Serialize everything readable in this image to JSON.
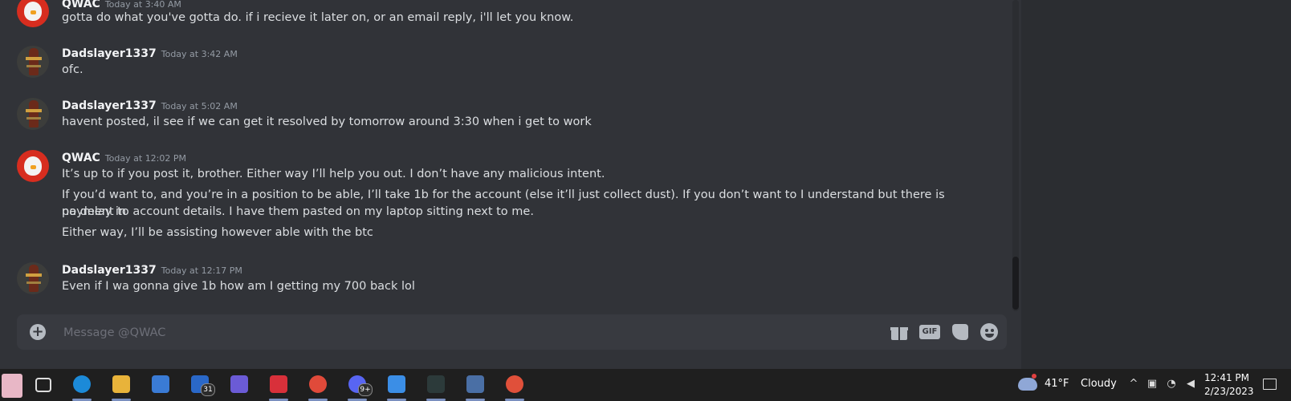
{
  "messages": [
    {
      "author": "QWAC",
      "time": "Today at 3:40 AM",
      "avatar": "qwac",
      "lines": [
        "gotta do what you've gotta do. if i recieve it later on, or an email reply, i'll let you know."
      ]
    },
    {
      "author": "Dadslayer1337",
      "time": "Today at 3:42 AM",
      "avatar": "dad",
      "lines": [
        "ofc."
      ]
    },
    {
      "author": "Dadslayer1337",
      "time": "Today at 5:02 AM",
      "avatar": "dad",
      "lines": [
        "havent posted, il see if we can get it resolved by tomorrow around 3:30 when i get to work"
      ]
    },
    {
      "author": "QWAC",
      "time": "Today at 12:02 PM",
      "avatar": "qwac",
      "lines": [
        "It’s up to if you post it, brother. Either way I’ll help you out. I don’t have any malicious intent.",
        "If you’d want to, and you’re in a position to be able, I’ll take 1b for the account (else it’ll just collect dust). If you don’t want to I understand but there is no delay in",
        "payment to account details. I have them pasted on my laptop sitting next to me.",
        "Either way, I’ll be assisting however able with the btc"
      ]
    },
    {
      "author": "Dadslayer1337",
      "time": "Today at 12:17 PM",
      "avatar": "dad",
      "lines": [
        "Even if I wa gonna give 1b how am I getting my 700 back lol"
      ]
    }
  ],
  "composer": {
    "placeholder": "Message @QWAC",
    "gif_label": "GIF"
  },
  "taskbar": {
    "apps": [
      {
        "name": "task-view",
        "color": "#1f1f1f"
      },
      {
        "name": "edge",
        "color": "#1c8ad8",
        "active": true
      },
      {
        "name": "file-explorer",
        "color": "#e8b33a",
        "active": true
      },
      {
        "name": "microsoft-store",
        "color": "#3a7bd5"
      },
      {
        "name": "mail",
        "color": "#2a68c8",
        "badge": "31"
      },
      {
        "name": "copilot",
        "color": "#6b5bd6"
      },
      {
        "name": "expressvpn",
        "color": "#d8303a",
        "active": true
      },
      {
        "name": "chrome",
        "color": "#e04a3a",
        "active": true
      },
      {
        "name": "discord",
        "color": "#5865f2",
        "badge": "9+",
        "active": true
      },
      {
        "name": "photos",
        "color": "#3b8ee6",
        "active": true
      },
      {
        "name": "runelite",
        "color": "#2c3a3a",
        "active": true
      },
      {
        "name": "calculator",
        "color": "#4a6fa5",
        "active": true
      },
      {
        "name": "edge-canary",
        "color": "#e0503a",
        "active": true
      }
    ],
    "weather": {
      "temp": "41°F",
      "condition": "Cloudy"
    },
    "clock": {
      "time": "12:41 PM",
      "date": "2/23/2023"
    }
  }
}
